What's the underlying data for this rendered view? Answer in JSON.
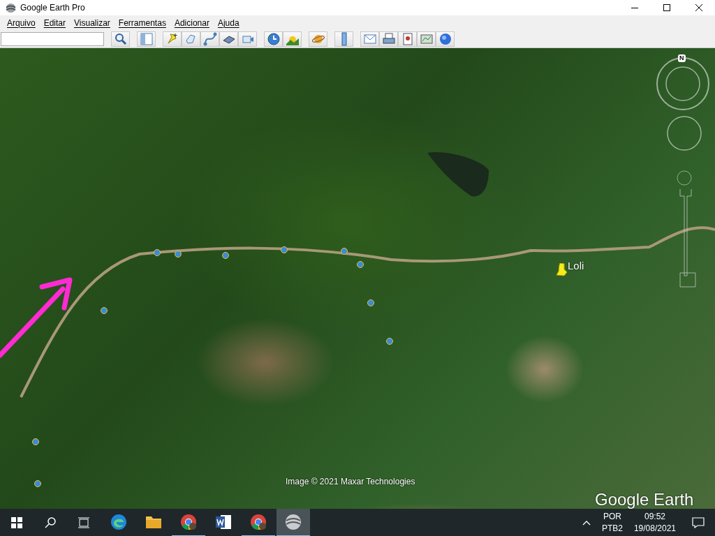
{
  "window": {
    "title": "Google Earth Pro"
  },
  "menu": [
    {
      "label": "Arquivo"
    },
    {
      "label": "Editar"
    },
    {
      "label": "Visualizar"
    },
    {
      "label": "Ferramentas"
    },
    {
      "label": "Adicionar"
    },
    {
      "label": "Ajuda"
    }
  ],
  "map": {
    "placemark": {
      "label": "Loli"
    },
    "compass": {
      "label": "N"
    },
    "attribution": "Image © 2021 Maxar Technologies",
    "logo": "Google Earth"
  },
  "taskbar": {
    "apps": [
      {
        "kind": "edge",
        "running": false,
        "active": false
      },
      {
        "kind": "folder",
        "running": false,
        "active": false
      },
      {
        "kind": "chrome",
        "running": true,
        "active": false
      },
      {
        "kind": "word",
        "running": false,
        "active": false
      },
      {
        "kind": "chrome",
        "running": true,
        "active": false
      },
      {
        "kind": "earth",
        "running": true,
        "active": true
      }
    ],
    "language": "POR",
    "layout": "PTB2",
    "time": "09:52",
    "date": "19/08/2021"
  }
}
